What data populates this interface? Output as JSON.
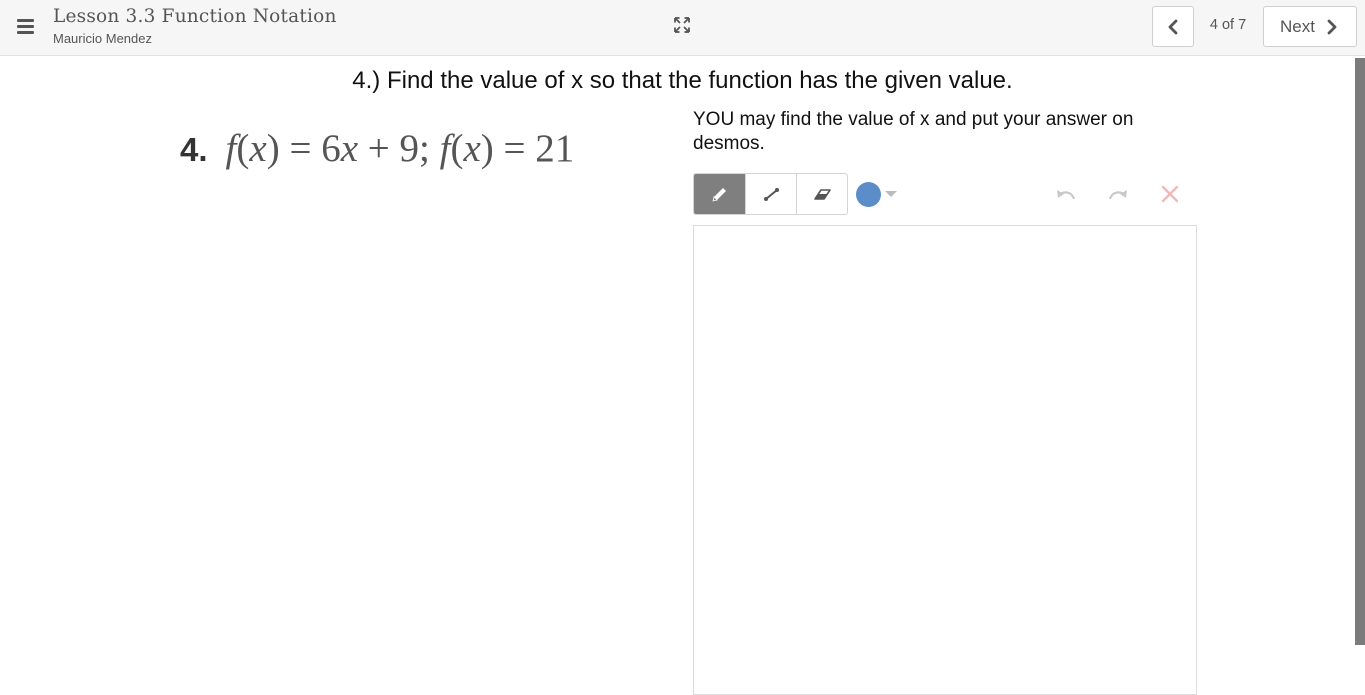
{
  "header": {
    "menu_icon": "hamburger-menu-icon",
    "lesson_title": "Lesson 3.3 Function Notation",
    "student_name": "Mauricio Mendez",
    "fullscreen_icon": "expand-icon",
    "prev_icon": "chevron-left-icon",
    "page_count": "4 of 7",
    "next_label": "Next",
    "next_icon": "chevron-right-icon"
  },
  "question": {
    "title": "4.) Find the value of x so that the function has the given value.",
    "problem_number": "4.",
    "problem_equation": "f(x) = 6x + 9;  f(x) = 21",
    "instructions": "YOU may find the value of x and put your answer on desmos."
  },
  "sketch_toolbar": {
    "tools": [
      "pencil-icon",
      "line-icon",
      "eraser-icon"
    ],
    "selected_tool": "pencil-icon",
    "pen_color": "#5b8ec9",
    "undo_icon": "undo-icon",
    "redo_icon": "redo-icon",
    "clear_icon": "clear-x-icon"
  },
  "colors": {
    "topbar_bg": "#f6f6f6",
    "active_tool_bg": "#7f7f7f",
    "clear_x": "#f2b8b8"
  }
}
